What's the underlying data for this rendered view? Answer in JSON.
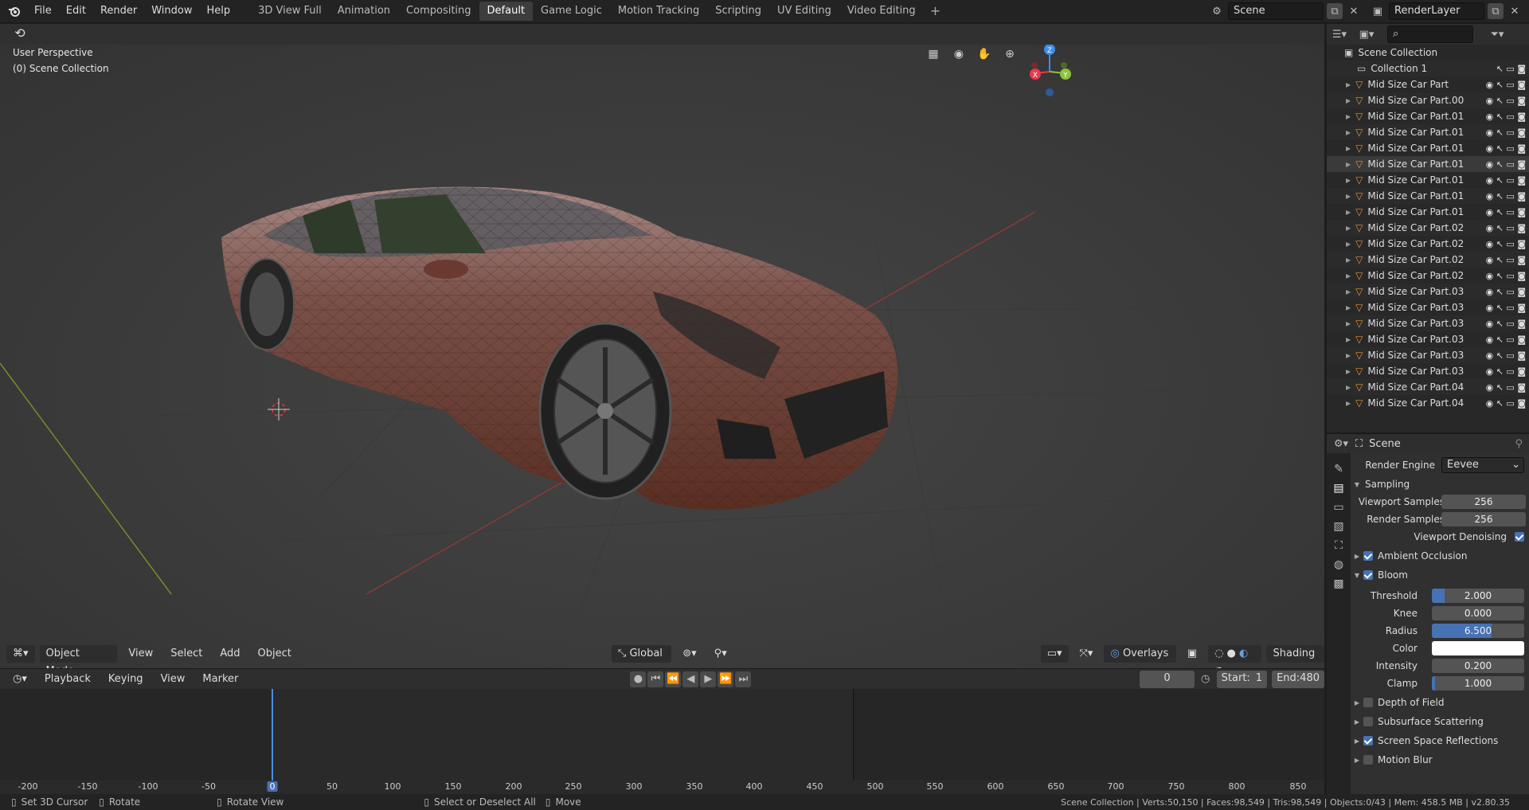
{
  "topbar": {
    "menu": [
      "File",
      "Edit",
      "Render",
      "Window",
      "Help"
    ],
    "workspaces": [
      "3D View Full",
      "Animation",
      "Compositing",
      "Default",
      "Game Logic",
      "Motion Tracking",
      "Scripting",
      "UV Editing",
      "Video Editing"
    ],
    "active_workspace": "Default",
    "scene": "Scene",
    "render_layer": "RenderLayer"
  },
  "viewport": {
    "perspective": "User Perspective",
    "collection": "(0) Scene Collection",
    "mode": "Object Mode",
    "menus": [
      "View",
      "Select",
      "Add",
      "Object"
    ],
    "transform": "Global",
    "overlays": "Overlays",
    "shading": "Shading",
    "axes": {
      "x": "X",
      "y": "Y",
      "z": "Z"
    }
  },
  "timeline": {
    "menus": [
      "Playback",
      "Keying",
      "View",
      "Marker"
    ],
    "current_frame": "0",
    "start_label": "Start:",
    "start": "1",
    "end_label": "End:",
    "end": "480",
    "ruler": [
      "-200",
      "-150",
      "-100",
      "-50",
      "0",
      "50",
      "100",
      "150",
      "200",
      "250",
      "300",
      "350",
      "400",
      "450",
      "500",
      "550",
      "600",
      "650",
      "700",
      "750",
      "800",
      "850"
    ]
  },
  "statusbar": {
    "hint1": "Set 3D Cursor",
    "hint2": "Rotate",
    "hint3": "Rotate View",
    "hint4": "Select or Deselect All",
    "hint5": "Move",
    "stats": "Scene Collection | Verts:50,150 | Faces:98,549 | Tris:98,549 | Objects:0/43 | Mem: 458.5 MB | v2.80.35"
  },
  "outliner": {
    "root": "Scene Collection",
    "collection": "Collection 1",
    "items": [
      "Mid Size Car Part",
      "Mid Size Car Part.00",
      "Mid Size Car Part.01",
      "Mid Size Car Part.01",
      "Mid Size Car Part.01",
      "Mid Size Car Part.01",
      "Mid Size Car Part.01",
      "Mid Size Car Part.01",
      "Mid Size Car Part.01",
      "Mid Size Car Part.02",
      "Mid Size Car Part.02",
      "Mid Size Car Part.02",
      "Mid Size Car Part.02",
      "Mid Size Car Part.03",
      "Mid Size Car Part.03",
      "Mid Size Car Part.03",
      "Mid Size Car Part.03",
      "Mid Size Car Part.03",
      "Mid Size Car Part.03",
      "Mid Size Car Part.04",
      "Mid Size Car Part.04"
    ]
  },
  "properties": {
    "context": "Scene",
    "render_engine_label": "Render Engine",
    "render_engine": "Eevee",
    "sampling": "Sampling",
    "viewport_samples_label": "Viewport Samples",
    "viewport_samples": "256",
    "render_samples_label": "Render Samples",
    "render_samples": "256",
    "viewport_denoising": "Viewport Denoising",
    "ambient_occlusion": "Ambient Occlusion",
    "bloom": "Bloom",
    "threshold_label": "Threshold",
    "threshold": "2.000",
    "knee_label": "Knee",
    "knee": "0.000",
    "radius_label": "Radius",
    "radius": "6.500",
    "color_label": "Color",
    "intensity_label": "Intensity",
    "intensity": "0.200",
    "clamp_label": "Clamp",
    "clamp": "1.000",
    "depth_of_field": "Depth of Field",
    "subsurface_scattering": "Subsurface Scattering",
    "screen_space_reflections": "Screen Space Reflections",
    "motion_blur": "Motion Blur"
  },
  "colors": {
    "accent": "#4772b3",
    "x_axis": "#e8394d",
    "y_axis": "#8bc33a",
    "z_axis": "#3d8ee6",
    "car_body": "#7a4a3e"
  }
}
